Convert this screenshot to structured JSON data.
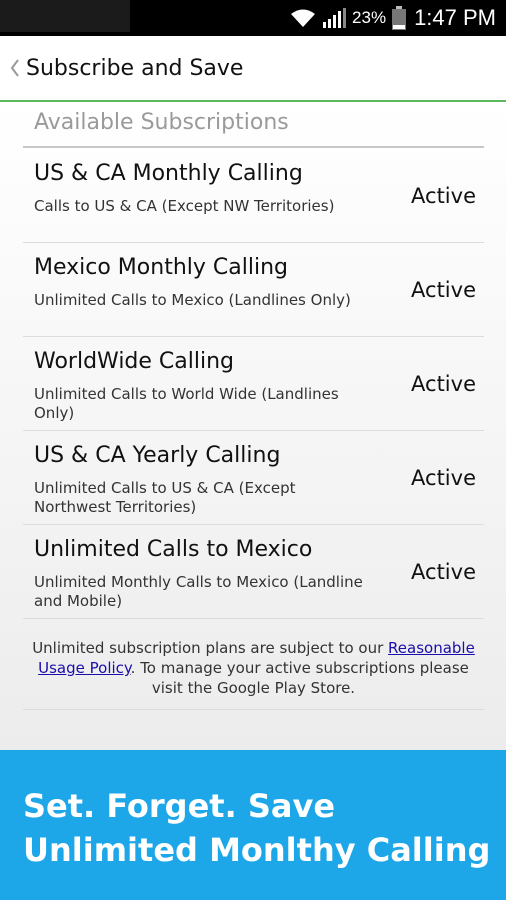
{
  "status_bar": {
    "battery_percent": "23%",
    "time": "1:47 PM",
    "icons": [
      "wifi-icon",
      "signal-icon",
      "battery-icon"
    ]
  },
  "action_bar": {
    "back_icon": "chevron-left-icon",
    "title": "Subscribe and Save"
  },
  "section_header": "Available Subscriptions",
  "subscriptions": [
    {
      "title": "US & CA Monthly Calling",
      "description": "Calls to US & CA (Except NW Territories)",
      "status": "Active"
    },
    {
      "title": "Mexico Monthly Calling",
      "description": "Unlimited Calls to Mexico (Landlines Only)",
      "status": "Active"
    },
    {
      "title": "WorldWide Calling",
      "description": "Unlimited Calls to World Wide (Landlines Only)",
      "status": "Active"
    },
    {
      "title": "US & CA Yearly Calling",
      "description": "Unlimited Calls to US & CA (Except Northwest Territories)",
      "status": "Active"
    },
    {
      "title": "Unlimited Calls to Mexico",
      "description": "Unlimited Monthly Calls to Mexico (Landline and Mobile)",
      "status": "Active"
    }
  ],
  "policy": {
    "text_before": "Unlimited subscription plans are subject to our ",
    "link_text": "Reasonable Usage Policy",
    "text_after": ". To manage your active subscriptions please visit the Google Play Store."
  },
  "promo": {
    "line1": "Set. Forget. Save",
    "line2": "Unlimited Monlthy Calling"
  },
  "colors": {
    "accent_green": "#5cb85c",
    "promo_blue": "#1ea7e8",
    "link_blue": "#1a0dab"
  }
}
